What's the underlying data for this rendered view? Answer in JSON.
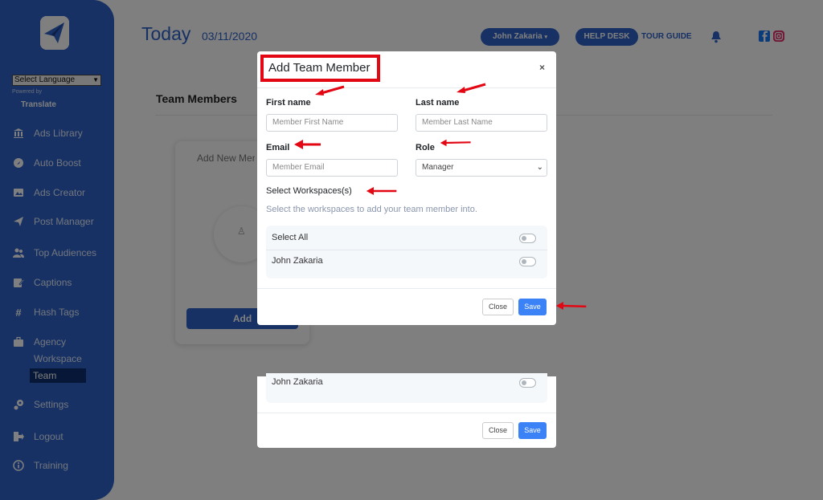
{
  "sidebar": {
    "language_select": "Select Language",
    "powered_by": "Powered by",
    "translate": "Translate",
    "items": [
      {
        "label": "Ads Library",
        "icon": "bank-icon"
      },
      {
        "label": "Auto Boost",
        "icon": "rocket-icon"
      },
      {
        "label": "Ads Creator",
        "icon": "image-icon"
      },
      {
        "label": "Post Manager",
        "icon": "paper-plane-icon"
      },
      {
        "label": "Top Audiences",
        "icon": "users-icon"
      },
      {
        "label": "Captions",
        "icon": "edit-icon"
      },
      {
        "label": "Hash Tags",
        "icon": "hashtag-icon"
      },
      {
        "label": "Agency",
        "icon": "briefcase-icon"
      },
      {
        "label": "Settings",
        "icon": "gears-icon"
      },
      {
        "label": "Logout",
        "icon": "sign-out-icon"
      },
      {
        "label": "Training",
        "icon": "info-icon"
      }
    ],
    "agency_sub": [
      "Workspace",
      "Team"
    ]
  },
  "header": {
    "today": "Today",
    "date": "03/11/2020",
    "user": "John Zakaria",
    "help_desk": "HELP DESK",
    "tour_guide": "TOUR GUIDE"
  },
  "page": {
    "section_title": "Team Members",
    "card_title": "Add New Member",
    "card_button": "Add"
  },
  "modal": {
    "title": "Add Team Member",
    "close_x": "×",
    "first_name_label": "First name",
    "first_name_placeholder": "Member First Name",
    "last_name_label": "Last name",
    "last_name_placeholder": "Member Last Name",
    "email_label": "Email",
    "email_placeholder": "Member Email",
    "role_label": "Role",
    "role_value": "Manager",
    "workspaces_title": "Select Workspaces(s)",
    "workspaces_desc": "Select the workspaces to add your team member into.",
    "workspaces": [
      "Select All",
      "John Zakaria"
    ],
    "close_button": "Close",
    "save_button": "Save"
  },
  "modal_ghost": {
    "workspace": "John Zakaria",
    "close_button": "Close",
    "save_button": "Save"
  },
  "colors": {
    "primary": "#2e62c8",
    "sidebar_active": "#0c2e70",
    "save": "#3b82f6",
    "annotation": "#e30613"
  }
}
